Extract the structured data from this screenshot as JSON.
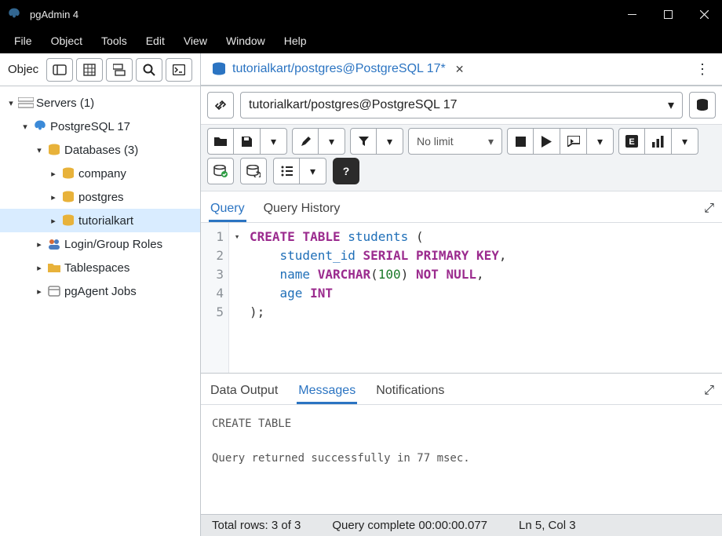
{
  "window": {
    "title": "pgAdmin 4"
  },
  "menu": [
    "File",
    "Object",
    "Tools",
    "Edit",
    "View",
    "Window",
    "Help"
  ],
  "sidebar": {
    "header_label": "Objec",
    "tree": {
      "servers": {
        "label": "Servers (1)"
      },
      "server": {
        "label": "PostgreSQL 17"
      },
      "databases": {
        "label": "Databases (3)"
      },
      "db0": {
        "label": "company"
      },
      "db1": {
        "label": "postgres"
      },
      "db2": {
        "label": "tutorialkart"
      },
      "login_roles": {
        "label": "Login/Group Roles"
      },
      "tablespaces": {
        "label": "Tablespaces"
      },
      "pgagent": {
        "label": "pgAgent Jobs"
      }
    }
  },
  "tab": {
    "title": "tutorialkart/postgres@PostgreSQL 17*",
    "connection": "tutorialkart/postgres@PostgreSQL 17"
  },
  "toolbar": {
    "limit_label": "No limit",
    "macro_letter": "E"
  },
  "subtabs": {
    "query": "Query",
    "history": "Query History"
  },
  "editor": {
    "lines": [
      "1",
      "2",
      "3",
      "4",
      "5"
    ]
  },
  "output_tabs": {
    "data": "Data Output",
    "messages": "Messages",
    "notifications": "Notifications"
  },
  "messages": {
    "line1": "CREATE TABLE",
    "line2": "Query returned successfully in 77 msec."
  },
  "status": {
    "rows": "Total rows: 3 of 3",
    "complete": "Query complete 00:00:00.077",
    "cursor": "Ln 5, Col 3"
  },
  "chart_data": {
    "type": "table",
    "title": "SQL query text",
    "sql": "CREATE TABLE students (\n    student_id SERIAL PRIMARY KEY,\n    name VARCHAR(100) NOT NULL,\n    age INT\n);"
  }
}
